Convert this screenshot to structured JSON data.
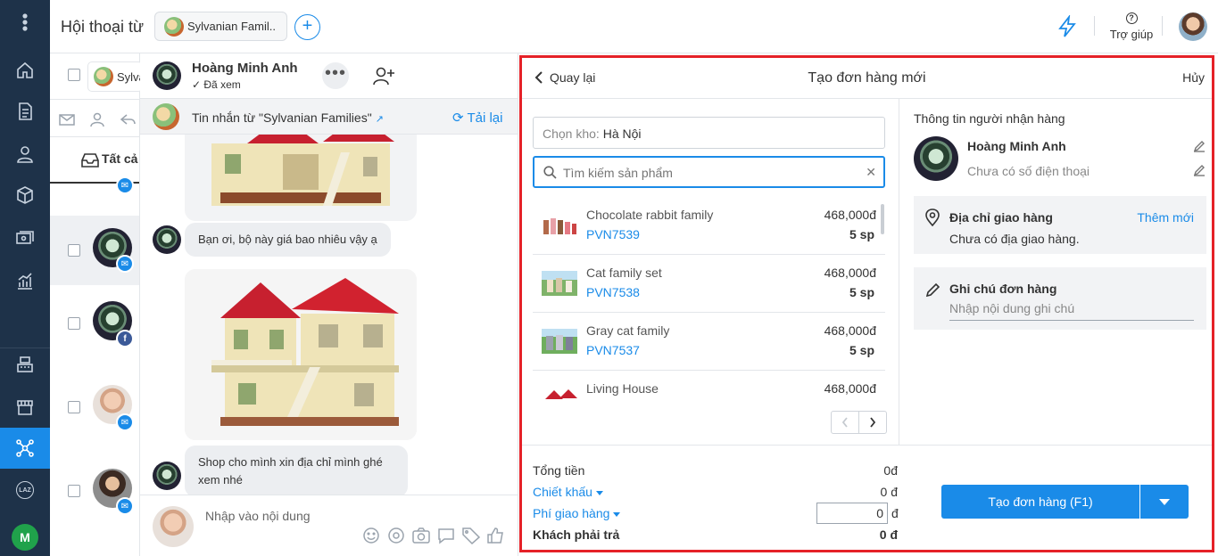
{
  "header": {
    "title": "Hội thoại từ",
    "page_tag": "Sylvanian Famil..",
    "help_label": "Trợ giúp"
  },
  "convlist": {
    "page_chip": "Sylvanian Families",
    "tab_all": "Tất cả"
  },
  "chat": {
    "name": "Hoàng Minh Anh",
    "seen": "✓ Đã xem",
    "source_prefix": "Tin nhắn từ",
    "source_page": "\"Sylvanian Families\"",
    "reload": "Tải lại",
    "messages": [
      "Bạn ơi, bộ này giá bao nhiêu vậy ạ",
      "Shop cho mình xin địa chỉ mình ghé xem nhé"
    ],
    "input_placeholder": "Nhập vào nội dung"
  },
  "order": {
    "back": "Quay lại",
    "title": "Tạo đơn hàng mới",
    "cancel": "Hủy",
    "warehouse_label": "Chọn kho:",
    "warehouse_value": "Hà Nội",
    "search_placeholder": "Tìm kiếm sản phẩm",
    "products": [
      {
        "name": "Chocolate rabbit family",
        "code": "PVN7539",
        "price": "468,000đ",
        "qty": "5 sp"
      },
      {
        "name": "Cat family set",
        "code": "PVN7538",
        "price": "468,000đ",
        "qty": "5 sp"
      },
      {
        "name": "Gray cat family",
        "code": "PVN7537",
        "price": "468,000đ",
        "qty": "5 sp"
      },
      {
        "name": "Living House",
        "code": "",
        "price": "468,000đ",
        "qty": ""
      }
    ],
    "recipient": {
      "section_title": "Thông tin người nhận hàng",
      "name": "Hoàng Minh Anh",
      "phone": "Chưa có số điện thoại"
    },
    "address": {
      "title": "Địa chỉ giao hàng",
      "add_label": "Thêm mới",
      "empty": "Chưa có địa giao hàng."
    },
    "note": {
      "title": "Ghi chú đơn hàng",
      "placeholder": "Nhập nội dung ghi chú"
    },
    "summary": {
      "total_label": "Tổng tiền",
      "total_value": "0đ",
      "discount_label": "Chiết khấu",
      "discount_value": "0 đ",
      "shipping_label": "Phí giao hàng",
      "shipping_value": "0",
      "shipping_unit": "đ",
      "payable_label": "Khách phải trả",
      "payable_value": "0 đ"
    },
    "create_button": "Tạo đơn hàng (F1)"
  },
  "colors": {
    "nav_bg": "#1e3249",
    "accent": "#1a8be8",
    "highlight_border": "#e52128"
  }
}
